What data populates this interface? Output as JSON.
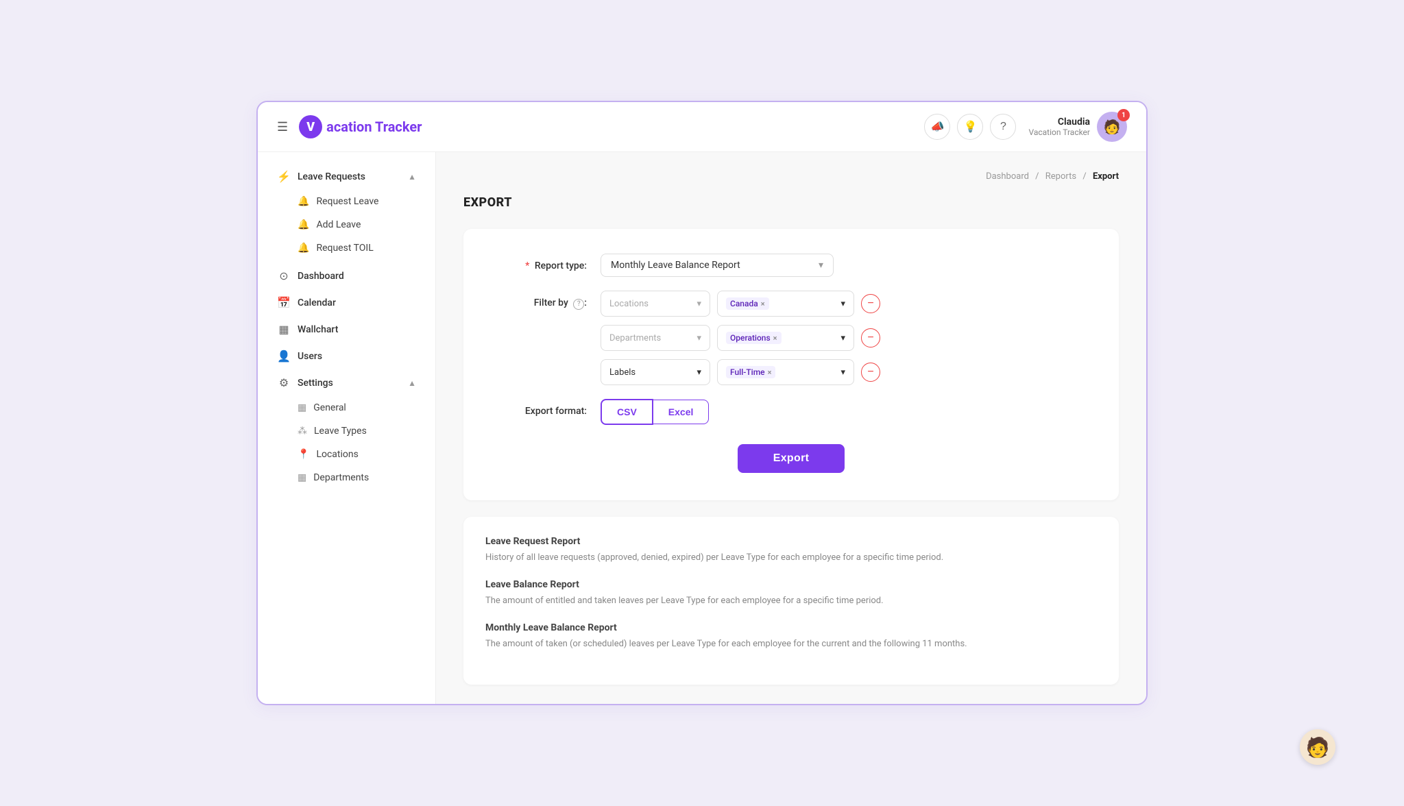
{
  "app": {
    "logo_letter": "V",
    "logo_text": "acation Tracker"
  },
  "header": {
    "user_name": "Claudia",
    "user_sub": "Vacation Tracker",
    "notification_count": "1",
    "icons": {
      "menu": "☰",
      "megaphone": "📣",
      "bulb": "💡",
      "question": "?"
    }
  },
  "sidebar": {
    "sections": [
      {
        "label": "Leave Requests",
        "icon": "⚡",
        "expandable": true,
        "expanded": true,
        "sub_items": [
          {
            "label": "Request Leave",
            "icon": "🔔"
          },
          {
            "label": "Add Leave",
            "icon": "🔔"
          },
          {
            "label": "Request TOIL",
            "icon": "🔔"
          }
        ]
      },
      {
        "label": "Dashboard",
        "icon": "⊙",
        "expandable": false
      },
      {
        "label": "Calendar",
        "icon": "📅",
        "expandable": false
      },
      {
        "label": "Wallchart",
        "icon": "▦",
        "expandable": false
      },
      {
        "label": "Users",
        "icon": "👤",
        "expandable": false
      },
      {
        "label": "Settings",
        "icon": "⚙",
        "expandable": true,
        "expanded": true,
        "sub_items": [
          {
            "label": "General",
            "icon": "▦"
          },
          {
            "label": "Leave Types",
            "icon": "⁂"
          },
          {
            "label": "Locations",
            "icon": "📍"
          },
          {
            "label": "Departments",
            "icon": "▦"
          }
        ]
      }
    ]
  },
  "breadcrumb": {
    "items": [
      "Dashboard",
      "Reports",
      "Export"
    ],
    "active": "Export"
  },
  "page": {
    "title": "EXPORT"
  },
  "form": {
    "report_type_label": "Report type:",
    "report_type_required": "*",
    "report_type_value": "Monthly Leave Balance Report",
    "filter_label": "Filter by",
    "filter_rows": [
      {
        "type": "Locations",
        "type_placeholder": true,
        "value_tag": "Canada",
        "value_tag2": null
      },
      {
        "type": "Departments",
        "type_placeholder": true,
        "value_tag": "Operations",
        "value_tag2": null
      },
      {
        "type": "Labels",
        "type_placeholder": false,
        "value_tag": "Full-Time",
        "value_tag2": null
      }
    ],
    "export_format_label": "Export format:",
    "format_options": [
      "CSV",
      "Excel"
    ],
    "format_selected": "CSV",
    "export_button_label": "Export"
  },
  "info_blocks": [
    {
      "title": "Leave Request Report",
      "desc": "History of all leave requests (approved, denied, expired) per Leave Type for each employee for a specific time period."
    },
    {
      "title": "Leave Balance Report",
      "desc": "The amount of entitled and taken leaves per Leave Type for each employee for a specific time period."
    },
    {
      "title": "Monthly Leave Balance Report",
      "desc": "The amount of taken (or scheduled) leaves per Leave Type for each employee for the current and the following 11 months."
    }
  ]
}
